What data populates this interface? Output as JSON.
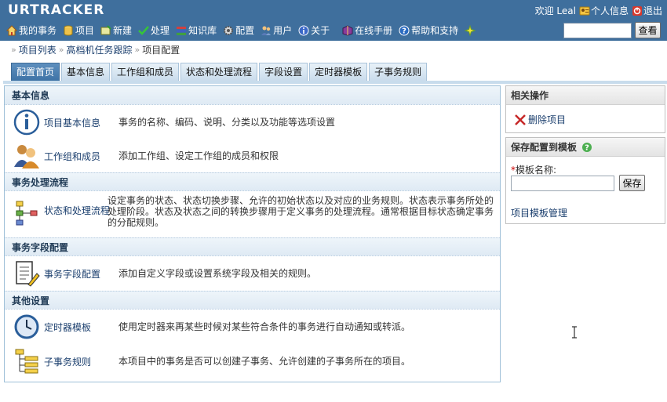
{
  "app": {
    "logo": "URTRACKER",
    "welcome": "欢迎 Leal",
    "personal_info": "个人信息",
    "logout": "退出"
  },
  "nav": {
    "items": [
      {
        "label": "我的事务",
        "icon": "home-icon"
      },
      {
        "label": "项目",
        "icon": "database-icon"
      },
      {
        "label": "新建",
        "icon": "new-icon"
      },
      {
        "label": "处理",
        "icon": "check-icon"
      },
      {
        "label": "知识库",
        "icon": "books-icon"
      },
      {
        "label": "配置",
        "icon": "gear-icon"
      },
      {
        "label": "用户",
        "icon": "users-icon"
      },
      {
        "label": "关于",
        "icon": "info-icon"
      },
      {
        "label": "在线手册",
        "icon": "manual-icon"
      },
      {
        "label": "帮助和支持",
        "icon": "help-icon"
      }
    ],
    "search_value": "",
    "search_button": "查看"
  },
  "breadcrumb": {
    "items": [
      "项目列表",
      "高档机任务跟踪",
      "项目配置"
    ]
  },
  "tabs": [
    {
      "label": "配置首页",
      "active": true
    },
    {
      "label": "基本信息",
      "active": false
    },
    {
      "label": "工作组和成员",
      "active": false
    },
    {
      "label": "状态和处理流程",
      "active": false
    },
    {
      "label": "字段设置",
      "active": false
    },
    {
      "label": "定时器模板",
      "active": false
    },
    {
      "label": "子事务规则",
      "active": false
    }
  ],
  "sections": {
    "basic": {
      "title": "基本信息",
      "rows": [
        {
          "title": "项目基本信息",
          "desc": "事务的名称、编码、说明、分类以及功能等选项设置",
          "icon": "info-circle-icon"
        },
        {
          "title": "工作组和成员",
          "desc": "添加工作组、设定工作组的成员和权限",
          "icon": "team-icon"
        }
      ]
    },
    "workflow": {
      "title": "事务处理流程",
      "rows": [
        {
          "title": "状态和处理流程",
          "desc": "设定事务的状态、状态切换步骤、允许的初始状态以及对应的业务规则。状态表示事务所处的处理阶段。状态及状态之间的转换步骤用于定义事务的处理流程。通常根据目标状态确定事务的分配规则。",
          "icon": "workflow-icon"
        }
      ]
    },
    "fields": {
      "title": "事务字段配置",
      "rows": [
        {
          "title": "事务字段配置",
          "desc": "添加自定义字段或设置系统字段及相关的规则。",
          "icon": "form-edit-icon"
        }
      ]
    },
    "other": {
      "title": "其他设置",
      "rows": [
        {
          "title": "定时器模板",
          "desc": "使用定时器来再某些时候对某些符合条件的事务进行自动通知或转派。",
          "icon": "clock-icon"
        },
        {
          "title": "子事务规则",
          "desc": "本项目中的事务是否可以创建子事务、允许创建的子事务所在的项目。",
          "icon": "tree-icon"
        }
      ]
    }
  },
  "side": {
    "related": {
      "title": "相关操作",
      "delete_link": "删除项目"
    },
    "save_tpl": {
      "title": "保存配置到模板",
      "required_mark": "*",
      "name_label": "模板名称:",
      "name_value": "",
      "save_button": "保存",
      "manage_link": "项目模板管理"
    }
  },
  "colors": {
    "header_bg": "#3f6f9d",
    "tab_active": "#4a7fb2",
    "link": "#1a3e6d"
  }
}
